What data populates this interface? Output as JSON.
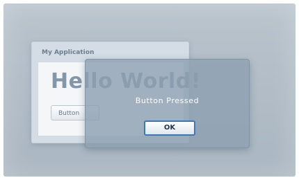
{
  "background_window": {
    "title": "My Application",
    "heading": "Hello World!",
    "button_label": "Button"
  },
  "dialog": {
    "message": "Button Pressed",
    "ok_label": "OK"
  },
  "colors": {
    "desktop_background": "#b2bdc7",
    "dialog_background": "#8ea0b1",
    "ok_button_border": "#3a78b8",
    "heading_text": "#8298aa"
  }
}
